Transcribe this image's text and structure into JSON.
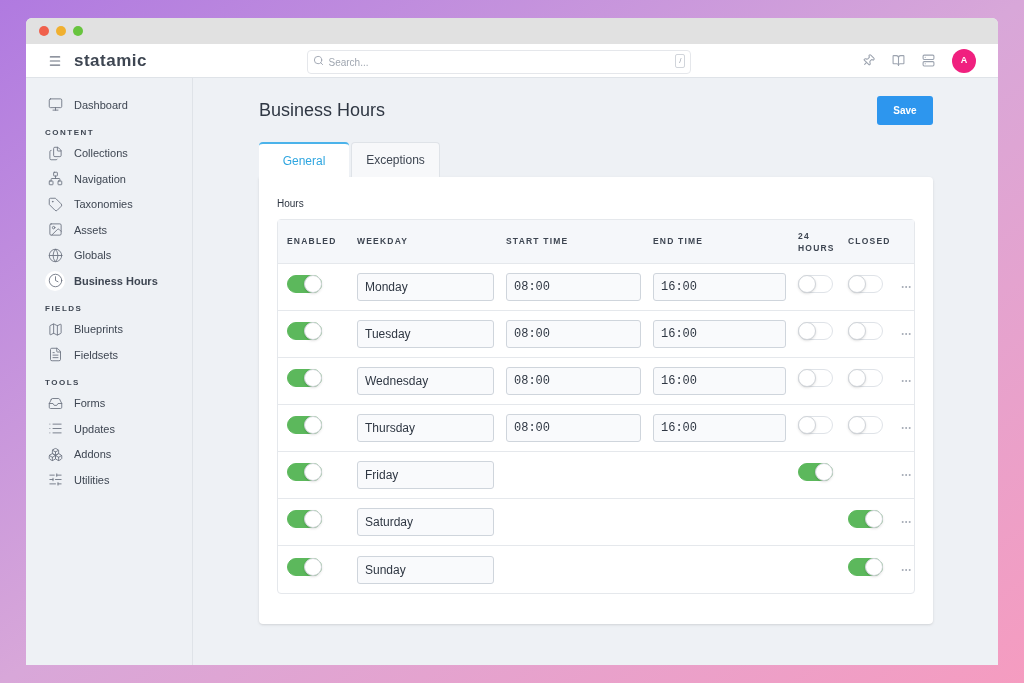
{
  "header": {
    "logo": "statamic",
    "search": {
      "placeholder": "Search...",
      "shortcut": "/"
    },
    "avatar": "A"
  },
  "sidebar": {
    "items": [
      {
        "label": "Dashboard",
        "selected": false
      }
    ],
    "sections": [
      {
        "title": "CONTENT",
        "items": [
          {
            "label": "Collections",
            "selected": false
          },
          {
            "label": "Navigation",
            "selected": false
          },
          {
            "label": "Taxonomies",
            "selected": false
          },
          {
            "label": "Assets",
            "selected": false
          },
          {
            "label": "Globals",
            "selected": false
          },
          {
            "label": "Business Hours",
            "selected": true
          }
        ]
      },
      {
        "title": "FIELDS",
        "items": [
          {
            "label": "Blueprints",
            "selected": false
          },
          {
            "label": "Fieldsets",
            "selected": false
          }
        ]
      },
      {
        "title": "TOOLS",
        "items": [
          {
            "label": "Forms",
            "selected": false
          },
          {
            "label": "Updates",
            "selected": false
          },
          {
            "label": "Addons",
            "selected": false
          },
          {
            "label": "Utilities",
            "selected": false
          }
        ]
      }
    ]
  },
  "page": {
    "title": "Business Hours",
    "save": "Save"
  },
  "tabs": [
    {
      "label": "General",
      "selected": true
    },
    {
      "label": "Exceptions",
      "selected": false
    }
  ],
  "section_label": "Hours",
  "table": {
    "columns": [
      "ENABLED",
      "WEEKDAY",
      "START TIME",
      "END TIME",
      "24 HOURS",
      "CLOSED"
    ],
    "rows": [
      {
        "enabled": true,
        "weekday": "Monday",
        "start": "08:00",
        "end": "16:00",
        "all_day": false,
        "closed": false
      },
      {
        "enabled": true,
        "weekday": "Tuesday",
        "start": "08:00",
        "end": "16:00",
        "all_day": false,
        "closed": false
      },
      {
        "enabled": true,
        "weekday": "Wednesday",
        "start": "08:00",
        "end": "16:00",
        "all_day": false,
        "closed": false
      },
      {
        "enabled": true,
        "weekday": "Thursday",
        "start": "08:00",
        "end": "16:00",
        "all_day": false,
        "closed": false
      },
      {
        "enabled": true,
        "weekday": "Friday",
        "all_day": true
      },
      {
        "enabled": true,
        "weekday": "Saturday",
        "closed": true
      },
      {
        "enabled": true,
        "weekday": "Sunday",
        "closed": true
      }
    ]
  }
}
